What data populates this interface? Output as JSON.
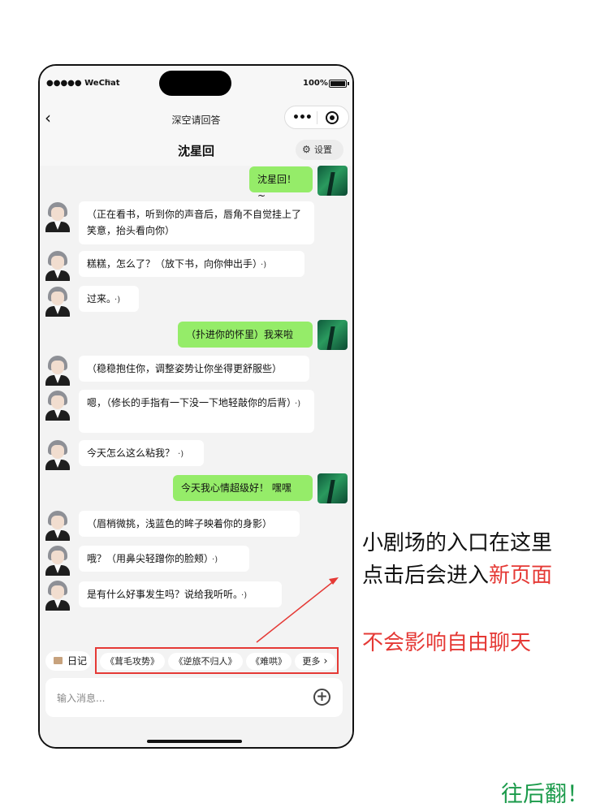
{
  "status_bar": {
    "carrier": "●●●●● WeChat",
    "battery": "100%"
  },
  "nav": {
    "title": "深空请回答"
  },
  "chat": {
    "character_name": "沈星回",
    "settings_label": "设置",
    "messages": [
      {
        "from": "user",
        "text": "沈星回！~"
      },
      {
        "from": "character",
        "text": "（正在看书，听到你的声音后，唇角不自觉挂上了笑意，抬头看向你）",
        "voice": false
      },
      {
        "from": "character",
        "text": "糕糕，怎么了？（放下书，向你伸出手）",
        "voice": true
      },
      {
        "from": "character",
        "text": "过来。",
        "voice": true
      },
      {
        "from": "user",
        "text": "（扑进你的怀里）我来啦"
      },
      {
        "from": "character",
        "text": "（稳稳抱住你，调整姿势让你坐得更舒服些）",
        "voice": false
      },
      {
        "from": "character",
        "text": "嗯，（修长的手指有一下没一下地轻敲你的后背）",
        "voice": true
      },
      {
        "from": "character",
        "text": "今天怎么这么粘我？",
        "voice": true
      },
      {
        "from": "user",
        "text": "今天我心情超级好！ 嘿嘿"
      },
      {
        "from": "character",
        "text": "（眉梢微挑，浅蓝色的眸子映着你的身影）",
        "voice": false
      },
      {
        "from": "character",
        "text": "哦？（用鼻尖轻蹭你的脸颊）",
        "voice": true
      },
      {
        "from": "character",
        "text": "是有什么好事发生吗？说给我听听。",
        "voice": true
      }
    ]
  },
  "bottom": {
    "diary_label": "日记",
    "quick_topics": [
      "《茸毛攻势》",
      "《逆旅不归人》",
      "《难哄》"
    ],
    "more_label": "更多",
    "input_placeholder": "输入消息..."
  },
  "annotations": {
    "line1": "小剧场的入口在这里",
    "line2_prefix": "点击后会进入",
    "line2_highlight": "新页面",
    "line3": "不会影响自由聊天",
    "footer": "往后翻！"
  },
  "colors": {
    "user_bubble": "#95ec69",
    "highlight_red": "#e53935",
    "footer_green": "#1a9a4a"
  }
}
